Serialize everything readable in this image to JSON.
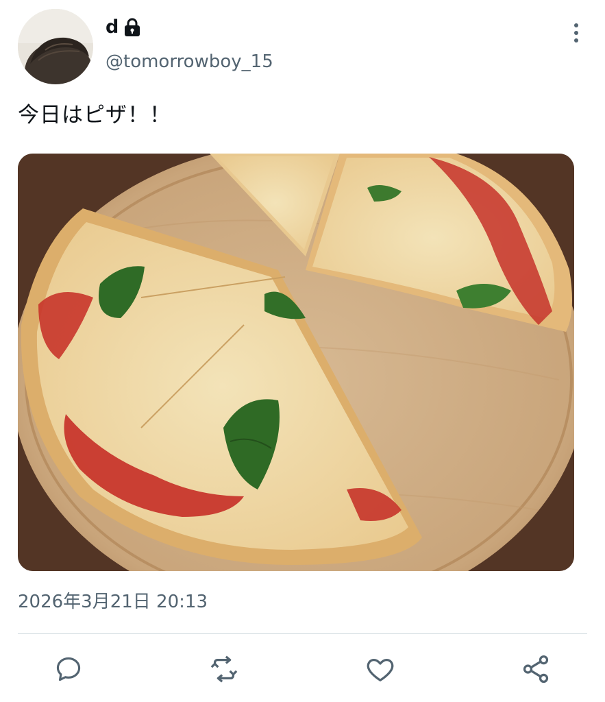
{
  "user": {
    "display_name": "d",
    "handle": "@tomorrowboy_15",
    "protected": true
  },
  "tweet": {
    "text": "今日はピザ！！",
    "timestamp": "2026年3月21日 20:13"
  },
  "actions": [
    {
      "icon": "reply-icon"
    },
    {
      "icon": "retweet-icon"
    },
    {
      "icon": "like-icon"
    },
    {
      "icon": "share-icon"
    }
  ],
  "colors": {
    "text": "#0f1419",
    "secondary": "#536471",
    "divider": "#cfd9de"
  }
}
